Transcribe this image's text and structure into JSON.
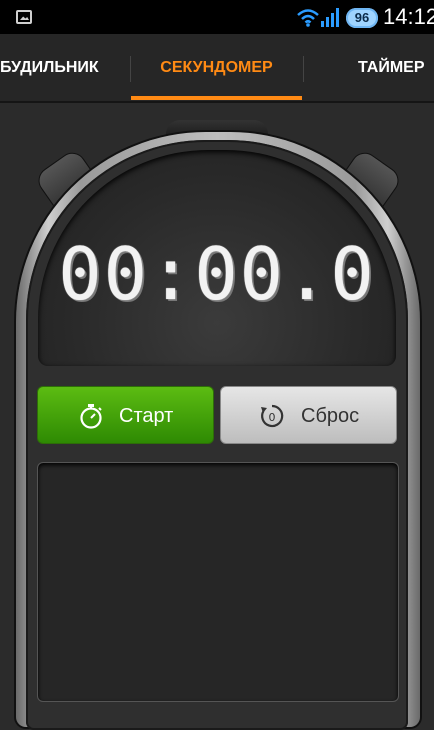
{
  "status_bar": {
    "battery": "96",
    "time": "14:12",
    "icons": [
      "image-notification-icon",
      "wifi-icon",
      "signal-icon",
      "battery-badge"
    ]
  },
  "tabs": [
    {
      "label": "БУДИЛЬНИК",
      "selected": false
    },
    {
      "label": "СЕКУНДОМЕР",
      "selected": true
    },
    {
      "label": "ТАЙМЕР",
      "selected": false
    }
  ],
  "colors": {
    "accent": "#ff8a14",
    "start_button": "#42a10a",
    "reset_button": "#d4d4d4",
    "background": "#2b2b2b"
  },
  "stopwatch": {
    "time": "00:00.0",
    "start_label": "Старт",
    "start_icon": "stopwatch-icon",
    "reset_label": "Сброс",
    "reset_icon": "reset-icon"
  }
}
